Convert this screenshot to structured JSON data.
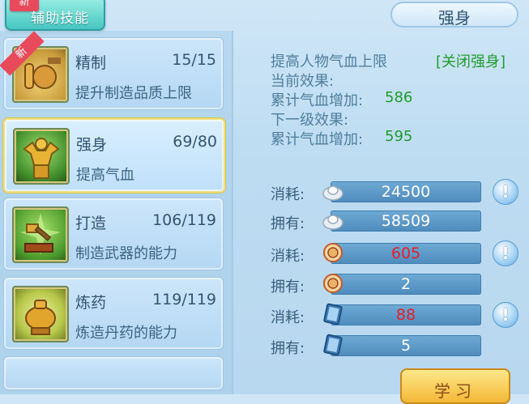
{
  "tab": {
    "label": "辅助技能",
    "badge": "新"
  },
  "skills": [
    {
      "name": "精制",
      "level": "15/15",
      "desc": "提升制造品质上限",
      "badge": "新"
    },
    {
      "name": "强身",
      "level": "69/80",
      "desc": "提高气血"
    },
    {
      "name": "打造",
      "level": "106/119",
      "desc": "制造武器的能力"
    },
    {
      "name": "炼药",
      "level": "119/119",
      "desc": "炼造丹药的能力"
    }
  ],
  "detail": {
    "title": "强身",
    "effect_text": "提高人物气血上限",
    "toggle": "[关闭强身]",
    "current_label": "当前效果:",
    "current_stat_label": "累计气血增加:",
    "current_value": "586",
    "next_label": "下一级效果:",
    "next_stat_label": "累计气血增加:",
    "next_value": "595"
  },
  "resources": [
    {
      "label": "消耗:",
      "icon": "silver-ingot-icon",
      "value": "24500",
      "warn": false,
      "info": true
    },
    {
      "label": "拥有:",
      "icon": "silver-ingot-icon",
      "value": "58509",
      "warn": false,
      "info": false
    },
    {
      "label": "消耗:",
      "icon": "contribution-medal-icon",
      "value": "605",
      "warn": true,
      "info": true
    },
    {
      "label": "拥有:",
      "icon": "contribution-medal-icon",
      "value": "2",
      "warn": false,
      "info": false
    },
    {
      "label": "消耗:",
      "icon": "skill-book-icon",
      "value": "88",
      "warn": true,
      "info": true
    },
    {
      "label": "拥有:",
      "icon": "skill-book-icon",
      "value": "5",
      "warn": false,
      "info": false
    }
  ],
  "info_glyph": "!",
  "learn_button": "学习",
  "colors": {
    "accent_green": "#1e9b2c",
    "warn_red": "#e81e2b",
    "bar_blue": "#5b98c8"
  }
}
